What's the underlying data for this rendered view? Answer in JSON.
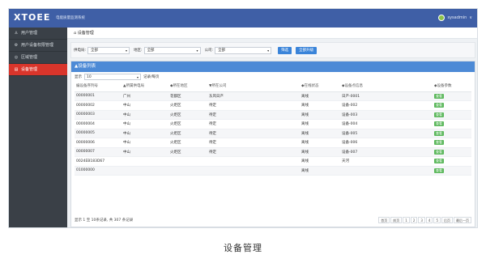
{
  "header": {
    "logo": "XTOEE",
    "subtitle": "电能质量监测系统",
    "user": "sysadmin",
    "user_caret": "∨"
  },
  "sidebar": {
    "items": [
      {
        "icon": "♙",
        "label": "用户管理",
        "active": false
      },
      {
        "icon": "⚙",
        "label": "用户设备权限管理",
        "active": false
      },
      {
        "icon": "◎",
        "label": "区域管理",
        "active": false
      },
      {
        "icon": "▤",
        "label": "设备管理",
        "active": true
      }
    ]
  },
  "breadcrumb": {
    "icon": "⌂",
    "text": "设备管理"
  },
  "filters": {
    "labels": [
      "供电局:",
      "地区:",
      "公司:"
    ],
    "values": [
      "全部",
      "全部",
      "全部"
    ],
    "search_label": "筛选",
    "add_label": "全部升级",
    "caret": "▾"
  },
  "panel": {
    "title": "▲设备列表",
    "pagesize_label": "显示",
    "pagesize_value": "10",
    "pagesize_suffix": "记录/每页"
  },
  "table": {
    "columns": [
      "编设备序列号",
      "▲所属供电局",
      "◆所在地区",
      "▼所在公司",
      "",
      "◆在线状态",
      "◆设备点信息",
      "",
      "◆设备参数"
    ],
    "rows": [
      [
        "00000001",
        "广州",
        "花都区",
        "东风日产",
        "",
        "离线",
        "日产-0001",
        "",
        "查看"
      ],
      [
        "00000002",
        "中山",
        "火炬区",
        "待定",
        "",
        "离线",
        "设备-002",
        "",
        "查看"
      ],
      [
        "00000003",
        "中山",
        "火炬区",
        "待定",
        "",
        "离线",
        "设备-003",
        "",
        "查看"
      ],
      [
        "00000004",
        "中山",
        "火炬区",
        "待定",
        "",
        "离线",
        "设备-004",
        "",
        "查看"
      ],
      [
        "00000005",
        "中山",
        "火炬区",
        "待定",
        "",
        "离线",
        "设备-005",
        "",
        "查看"
      ],
      [
        "00000006",
        "中山",
        "火炬区",
        "待定",
        "",
        "离线",
        "设备-006",
        "",
        "查看"
      ],
      [
        "00000007",
        "中山",
        "火炬区",
        "待定",
        "",
        "离线",
        "设备-007",
        "",
        "查看"
      ],
      [
        "0024EB183D67",
        "",
        "",
        "",
        "",
        "离线",
        "天河",
        "",
        "查看"
      ],
      [
        "01000000",
        "",
        "",
        "",
        "",
        "离线",
        "",
        "",
        "查看"
      ]
    ]
  },
  "footer": {
    "summary": "显示 1 至 10条记录, 共 307 条记录",
    "pages": [
      "首页",
      "前页",
      "1",
      "2",
      "3",
      "4",
      "5",
      "后页",
      "最后一页"
    ]
  },
  "caption": "设备管理"
}
